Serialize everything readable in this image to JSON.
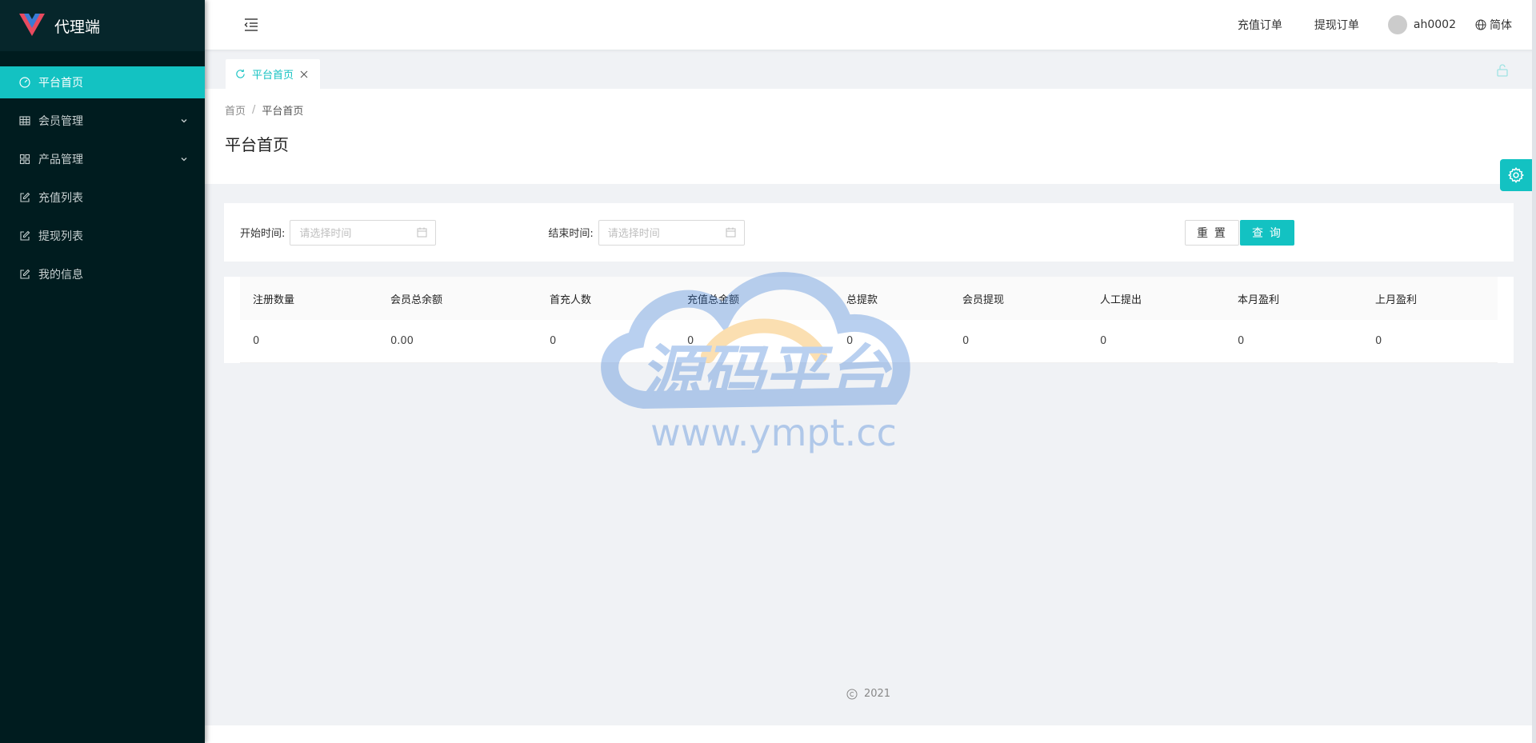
{
  "app": {
    "title": "代理端",
    "brand_color": "#13c2c2",
    "sidebar_bg": "#001c1f"
  },
  "sidebar": {
    "items": [
      {
        "label": "平台首页",
        "icon": "dashboard-icon",
        "active": true
      },
      {
        "label": "会员管理",
        "icon": "table-icon",
        "expandable": true
      },
      {
        "label": "产品管理",
        "icon": "appstore-icon",
        "expandable": true
      },
      {
        "label": "充值列表",
        "icon": "edit-icon"
      },
      {
        "label": "提现列表",
        "icon": "edit-icon"
      },
      {
        "label": "我的信息",
        "icon": "edit-icon"
      }
    ]
  },
  "header": {
    "links": [
      "充值订单",
      "提现订单"
    ],
    "username": "ah0002",
    "language": "简体"
  },
  "tabs": [
    {
      "label": "平台首页"
    }
  ],
  "breadcrumb": {
    "home": "首页",
    "separator": "/",
    "current": "平台首页"
  },
  "page_title": "平台首页",
  "filters": {
    "start_label": "开始时间:",
    "start_placeholder": "请选择时间",
    "end_label": "结束时间:",
    "end_placeholder": "请选择时间",
    "reset_label": "重 置",
    "query_label": "查 询"
  },
  "table": {
    "columns": [
      "注册数量",
      "会员总余额",
      "首充人数",
      "充值总金额",
      "总提款",
      "会员提现",
      "人工提出",
      "本月盈利",
      "上月盈利"
    ],
    "rows": [
      [
        "0",
        "0.00",
        "0",
        "0",
        "0",
        "0",
        "0",
        "0",
        "0"
      ]
    ]
  },
  "watermark": {
    "text": "源码平台",
    "url": "www.ympt.cc"
  },
  "footer": {
    "copyright": "2021"
  }
}
